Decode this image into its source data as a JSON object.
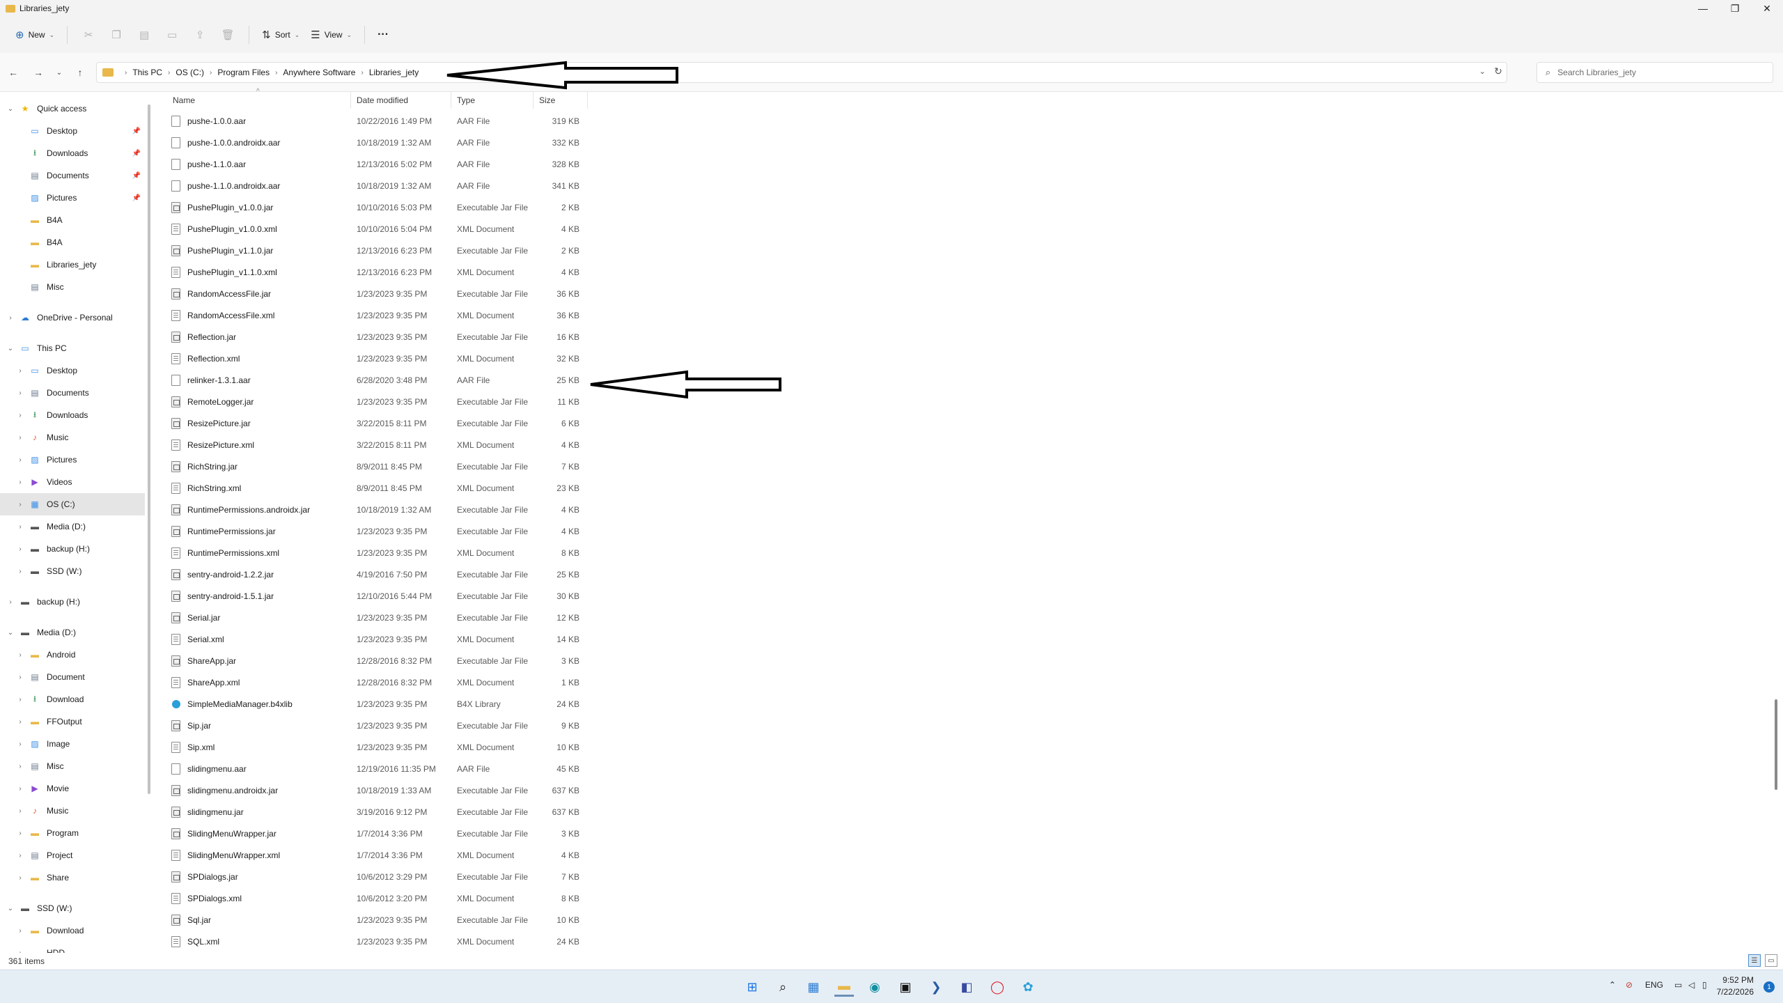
{
  "window": {
    "title": "Libraries_jety",
    "minimize": "—",
    "maximize": "❐",
    "close": "✕"
  },
  "toolbar": {
    "new_label": "New",
    "sort_label": "Sort",
    "view_label": "View",
    "more_label": "···"
  },
  "address": {
    "breadcrumbs": [
      "This PC",
      "OS (C:)",
      "Program Files",
      "Anywhere Software",
      "Libraries_jety"
    ]
  },
  "search": {
    "placeholder": "Search Libraries_jety"
  },
  "nav": {
    "items": [
      {
        "label": "Quick access",
        "icon": "star-icon",
        "color": "#f2b705",
        "chev": "⌄",
        "indent": 0,
        "pin": false
      },
      {
        "label": "Desktop",
        "icon": "desktop-icon",
        "color": "#3a8ee6",
        "chev": "",
        "indent": 1,
        "pin": true
      },
      {
        "label": "Downloads",
        "icon": "download-icon",
        "color": "#2d8a4e",
        "chev": "",
        "indent": 1,
        "pin": true
      },
      {
        "label": "Documents",
        "icon": "document-icon",
        "color": "#6b7a8a",
        "chev": "",
        "indent": 1,
        "pin": true
      },
      {
        "label": "Pictures",
        "icon": "pictures-icon",
        "color": "#3a8ee6",
        "chev": "",
        "indent": 1,
        "pin": true
      },
      {
        "label": "B4A",
        "icon": "folder-icon",
        "color": "#e8b84a",
        "chev": "",
        "indent": 1,
        "pin": false
      },
      {
        "label": "B4A",
        "icon": "folder-icon",
        "color": "#e8b84a",
        "chev": "",
        "indent": 1,
        "pin": false
      },
      {
        "label": "Libraries_jety",
        "icon": "folder-icon",
        "color": "#e8b84a",
        "chev": "",
        "indent": 1,
        "pin": false
      },
      {
        "label": "Misc",
        "icon": "document-icon",
        "color": "#6b7a8a",
        "chev": "",
        "indent": 1,
        "pin": false
      },
      {
        "label": "OneDrive - Personal",
        "icon": "cloud-icon",
        "color": "#2b7cd3",
        "chev": "›",
        "indent": 0,
        "pin": false
      },
      {
        "label": "This PC",
        "icon": "computer-icon",
        "color": "#3a8ee6",
        "chev": "⌄",
        "indent": 0,
        "pin": false
      },
      {
        "label": "Desktop",
        "icon": "desktop-icon",
        "color": "#3a8ee6",
        "chev": "›",
        "indent": 1,
        "pin": false
      },
      {
        "label": "Documents",
        "icon": "document-icon",
        "color": "#6b7a8a",
        "chev": "›",
        "indent": 1,
        "pin": false
      },
      {
        "label": "Downloads",
        "icon": "download-icon",
        "color": "#2d8a4e",
        "chev": "›",
        "indent": 1,
        "pin": false
      },
      {
        "label": "Music",
        "icon": "music-icon",
        "color": "#e0602a",
        "chev": "›",
        "indent": 1,
        "pin": false
      },
      {
        "label": "Pictures",
        "icon": "pictures-icon",
        "color": "#3a8ee6",
        "chev": "›",
        "indent": 1,
        "pin": false
      },
      {
        "label": "Videos",
        "icon": "video-icon",
        "color": "#8b4bd1",
        "chev": "›",
        "indent": 1,
        "pin": false
      },
      {
        "label": "OS (C:)",
        "icon": "os-drive-icon",
        "color": "#3a8ee6",
        "chev": "›",
        "indent": 1,
        "pin": false,
        "selected": true
      },
      {
        "label": "Media (D:)",
        "icon": "drive-icon",
        "color": "#555555",
        "chev": "›",
        "indent": 1,
        "pin": false
      },
      {
        "label": "backup (H:)",
        "icon": "drive-icon",
        "color": "#555555",
        "chev": "›",
        "indent": 1,
        "pin": false
      },
      {
        "label": "SSD (W:)",
        "icon": "drive-icon",
        "color": "#555555",
        "chev": "›",
        "indent": 1,
        "pin": false
      },
      {
        "label": "backup (H:)",
        "icon": "drive-icon",
        "color": "#555555",
        "chev": "›",
        "indent": 0,
        "pin": false
      },
      {
        "label": "Media (D:)",
        "icon": "drive-icon",
        "color": "#555555",
        "chev": "⌄",
        "indent": 0,
        "pin": false
      },
      {
        "label": "Android",
        "icon": "folder-icon",
        "color": "#e8b84a",
        "chev": "›",
        "indent": 1,
        "pin": false
      },
      {
        "label": "Document",
        "icon": "document-icon",
        "color": "#6b7a8a",
        "chev": "›",
        "indent": 1,
        "pin": false
      },
      {
        "label": "Download",
        "icon": "download-icon",
        "color": "#2d8a4e",
        "chev": "›",
        "indent": 1,
        "pin": false
      },
      {
        "label": "FFOutput",
        "icon": "folder-icon",
        "color": "#e8b84a",
        "chev": "›",
        "indent": 1,
        "pin": false
      },
      {
        "label": "Image",
        "icon": "pictures-icon",
        "color": "#3a8ee6",
        "chev": "›",
        "indent": 1,
        "pin": false
      },
      {
        "label": "Misc",
        "icon": "document-icon",
        "color": "#6b7a8a",
        "chev": "›",
        "indent": 1,
        "pin": false
      },
      {
        "label": "Movie",
        "icon": "video-icon",
        "color": "#8b4bd1",
        "chev": "›",
        "indent": 1,
        "pin": false
      },
      {
        "label": "Music",
        "icon": "music-icon",
        "color": "#e0602a",
        "chev": "›",
        "indent": 1,
        "pin": false
      },
      {
        "label": "Program",
        "icon": "folder-icon",
        "color": "#e8b84a",
        "chev": "›",
        "indent": 1,
        "pin": false
      },
      {
        "label": "Project",
        "icon": "document-icon",
        "color": "#6b7a8a",
        "chev": "›",
        "indent": 1,
        "pin": false
      },
      {
        "label": "Share",
        "icon": "folder-icon",
        "color": "#e8b84a",
        "chev": "›",
        "indent": 1,
        "pin": false
      },
      {
        "label": "SSD (W:)",
        "icon": "drive-icon",
        "color": "#555555",
        "chev": "⌄",
        "indent": 0,
        "pin": false
      },
      {
        "label": "Download",
        "icon": "folder-icon",
        "color": "#e8b84a",
        "chev": "›",
        "indent": 1,
        "pin": false
      },
      {
        "label": "HDD",
        "icon": "folder-icon",
        "color": "#e8b84a",
        "chev": "›",
        "indent": 1,
        "pin": false
      }
    ]
  },
  "list": {
    "columns": {
      "name": "Name",
      "date": "Date modified",
      "type": "Type",
      "size": "Size"
    },
    "sort_indicator": "^",
    "files": [
      {
        "name": "pushe-1.0.0.aar",
        "date": "10/22/2016 1:49 PM",
        "type": "AAR File",
        "size": "319 KB",
        "icon": "file-icon"
      },
      {
        "name": "pushe-1.0.0.androidx.aar",
        "date": "10/18/2019 1:32 AM",
        "type": "AAR File",
        "size": "332 KB",
        "icon": "file-icon"
      },
      {
        "name": "pushe-1.1.0.aar",
        "date": "12/13/2016 5:02 PM",
        "type": "AAR File",
        "size": "328 KB",
        "icon": "file-icon"
      },
      {
        "name": "pushe-1.1.0.androidx.aar",
        "date": "10/18/2019 1:32 AM",
        "type": "AAR File",
        "size": "341 KB",
        "icon": "file-icon"
      },
      {
        "name": "PushePlugin_v1.0.0.jar",
        "date": "10/10/2016 5:03 PM",
        "type": "Executable Jar File",
        "size": "2 KB",
        "icon": "jar-file-icon"
      },
      {
        "name": "PushePlugin_v1.0.0.xml",
        "date": "10/10/2016 5:04 PM",
        "type": "XML Document",
        "size": "4 KB",
        "icon": "xml-file-icon"
      },
      {
        "name": "PushePlugin_v1.1.0.jar",
        "date": "12/13/2016 6:23 PM",
        "type": "Executable Jar File",
        "size": "2 KB",
        "icon": "jar-file-icon"
      },
      {
        "name": "PushePlugin_v1.1.0.xml",
        "date": "12/13/2016 6:23 PM",
        "type": "XML Document",
        "size": "4 KB",
        "icon": "xml-file-icon"
      },
      {
        "name": "RandomAccessFile.jar",
        "date": "1/23/2023 9:35 PM",
        "type": "Executable Jar File",
        "size": "36 KB",
        "icon": "jar-file-icon"
      },
      {
        "name": "RandomAccessFile.xml",
        "date": "1/23/2023 9:35 PM",
        "type": "XML Document",
        "size": "36 KB",
        "icon": "xml-file-icon"
      },
      {
        "name": "Reflection.jar",
        "date": "1/23/2023 9:35 PM",
        "type": "Executable Jar File",
        "size": "16 KB",
        "icon": "jar-file-icon"
      },
      {
        "name": "Reflection.xml",
        "date": "1/23/2023 9:35 PM",
        "type": "XML Document",
        "size": "32 KB",
        "icon": "xml-file-icon"
      },
      {
        "name": "relinker-1.3.1.aar",
        "date": "6/28/2020 3:48 PM",
        "type": "AAR File",
        "size": "25 KB",
        "icon": "file-icon"
      },
      {
        "name": "RemoteLogger.jar",
        "date": "1/23/2023 9:35 PM",
        "type": "Executable Jar File",
        "size": "11 KB",
        "icon": "jar-file-icon"
      },
      {
        "name": "ResizePicture.jar",
        "date": "3/22/2015 8:11 PM",
        "type": "Executable Jar File",
        "size": "6 KB",
        "icon": "jar-file-icon"
      },
      {
        "name": "ResizePicture.xml",
        "date": "3/22/2015 8:11 PM",
        "type": "XML Document",
        "size": "4 KB",
        "icon": "xml-file-icon"
      },
      {
        "name": "RichString.jar",
        "date": "8/9/2011 8:45 PM",
        "type": "Executable Jar File",
        "size": "7 KB",
        "icon": "jar-file-icon"
      },
      {
        "name": "RichString.xml",
        "date": "8/9/2011 8:45 PM",
        "type": "XML Document",
        "size": "23 KB",
        "icon": "xml-file-icon"
      },
      {
        "name": "RuntimePermissions.androidx.jar",
        "date": "10/18/2019 1:32 AM",
        "type": "Executable Jar File",
        "size": "4 KB",
        "icon": "jar-file-icon"
      },
      {
        "name": "RuntimePermissions.jar",
        "date": "1/23/2023 9:35 PM",
        "type": "Executable Jar File",
        "size": "4 KB",
        "icon": "jar-file-icon"
      },
      {
        "name": "RuntimePermissions.xml",
        "date": "1/23/2023 9:35 PM",
        "type": "XML Document",
        "size": "8 KB",
        "icon": "xml-file-icon"
      },
      {
        "name": "sentry-android-1.2.2.jar",
        "date": "4/19/2016 7:50 PM",
        "type": "Executable Jar File",
        "size": "25 KB",
        "icon": "jar-file-icon"
      },
      {
        "name": "sentry-android-1.5.1.jar",
        "date": "12/10/2016 5:44 PM",
        "type": "Executable Jar File",
        "size": "30 KB",
        "icon": "jar-file-icon"
      },
      {
        "name": "Serial.jar",
        "date": "1/23/2023 9:35 PM",
        "type": "Executable Jar File",
        "size": "12 KB",
        "icon": "jar-file-icon"
      },
      {
        "name": "Serial.xml",
        "date": "1/23/2023 9:35 PM",
        "type": "XML Document",
        "size": "14 KB",
        "icon": "xml-file-icon"
      },
      {
        "name": "ShareApp.jar",
        "date": "12/28/2016 8:32 PM",
        "type": "Executable Jar File",
        "size": "3 KB",
        "icon": "jar-file-icon"
      },
      {
        "name": "ShareApp.xml",
        "date": "12/28/2016 8:32 PM",
        "type": "XML Document",
        "size": "1 KB",
        "icon": "xml-file-icon"
      },
      {
        "name": "SimpleMediaManager.b4xlib",
        "date": "1/23/2023 9:35 PM",
        "type": "B4X Library",
        "size": "24 KB",
        "icon": "b4x-library-icon"
      },
      {
        "name": "Sip.jar",
        "date": "1/23/2023 9:35 PM",
        "type": "Executable Jar File",
        "size": "9 KB",
        "icon": "jar-file-icon"
      },
      {
        "name": "Sip.xml",
        "date": "1/23/2023 9:35 PM",
        "type": "XML Document",
        "size": "10 KB",
        "icon": "xml-file-icon"
      },
      {
        "name": "slidingmenu.aar",
        "date": "12/19/2016 11:35 PM",
        "type": "AAR File",
        "size": "45 KB",
        "icon": "file-icon"
      },
      {
        "name": "slidingmenu.androidx.jar",
        "date": "10/18/2019 1:33 AM",
        "type": "Executable Jar File",
        "size": "637 KB",
        "icon": "jar-file-icon"
      },
      {
        "name": "slidingmenu.jar",
        "date": "3/19/2016 9:12 PM",
        "type": "Executable Jar File",
        "size": "637 KB",
        "icon": "jar-file-icon"
      },
      {
        "name": "SlidingMenuWrapper.jar",
        "date": "1/7/2014 3:36 PM",
        "type": "Executable Jar File",
        "size": "3 KB",
        "icon": "jar-file-icon"
      },
      {
        "name": "SlidingMenuWrapper.xml",
        "date": "1/7/2014 3:36 PM",
        "type": "XML Document",
        "size": "4 KB",
        "icon": "xml-file-icon"
      },
      {
        "name": "SPDialogs.jar",
        "date": "10/6/2012 3:29 PM",
        "type": "Executable Jar File",
        "size": "7 KB",
        "icon": "jar-file-icon"
      },
      {
        "name": "SPDialogs.xml",
        "date": "10/6/2012 3:20 PM",
        "type": "XML Document",
        "size": "8 KB",
        "icon": "xml-file-icon"
      },
      {
        "name": "Sql.jar",
        "date": "1/23/2023 9:35 PM",
        "type": "Executable Jar File",
        "size": "10 KB",
        "icon": "jar-file-icon"
      },
      {
        "name": "SQL.xml",
        "date": "1/23/2023 9:35 PM",
        "type": "XML Document",
        "size": "24 KB",
        "icon": "xml-file-icon"
      }
    ]
  },
  "status": {
    "item_count": "361 items"
  },
  "taskbar": {
    "icons": [
      "windows-start-icon",
      "search-icon",
      "widgets-icon",
      "file-explorer-icon",
      "edge-icon",
      "terminal-icon",
      "powershell-icon",
      "teams-icon",
      "opera-icon",
      "b4x-icon"
    ],
    "language": "ENG",
    "time": "9:52 PM",
    "date": "7/22/2026",
    "notification_count": "1"
  }
}
